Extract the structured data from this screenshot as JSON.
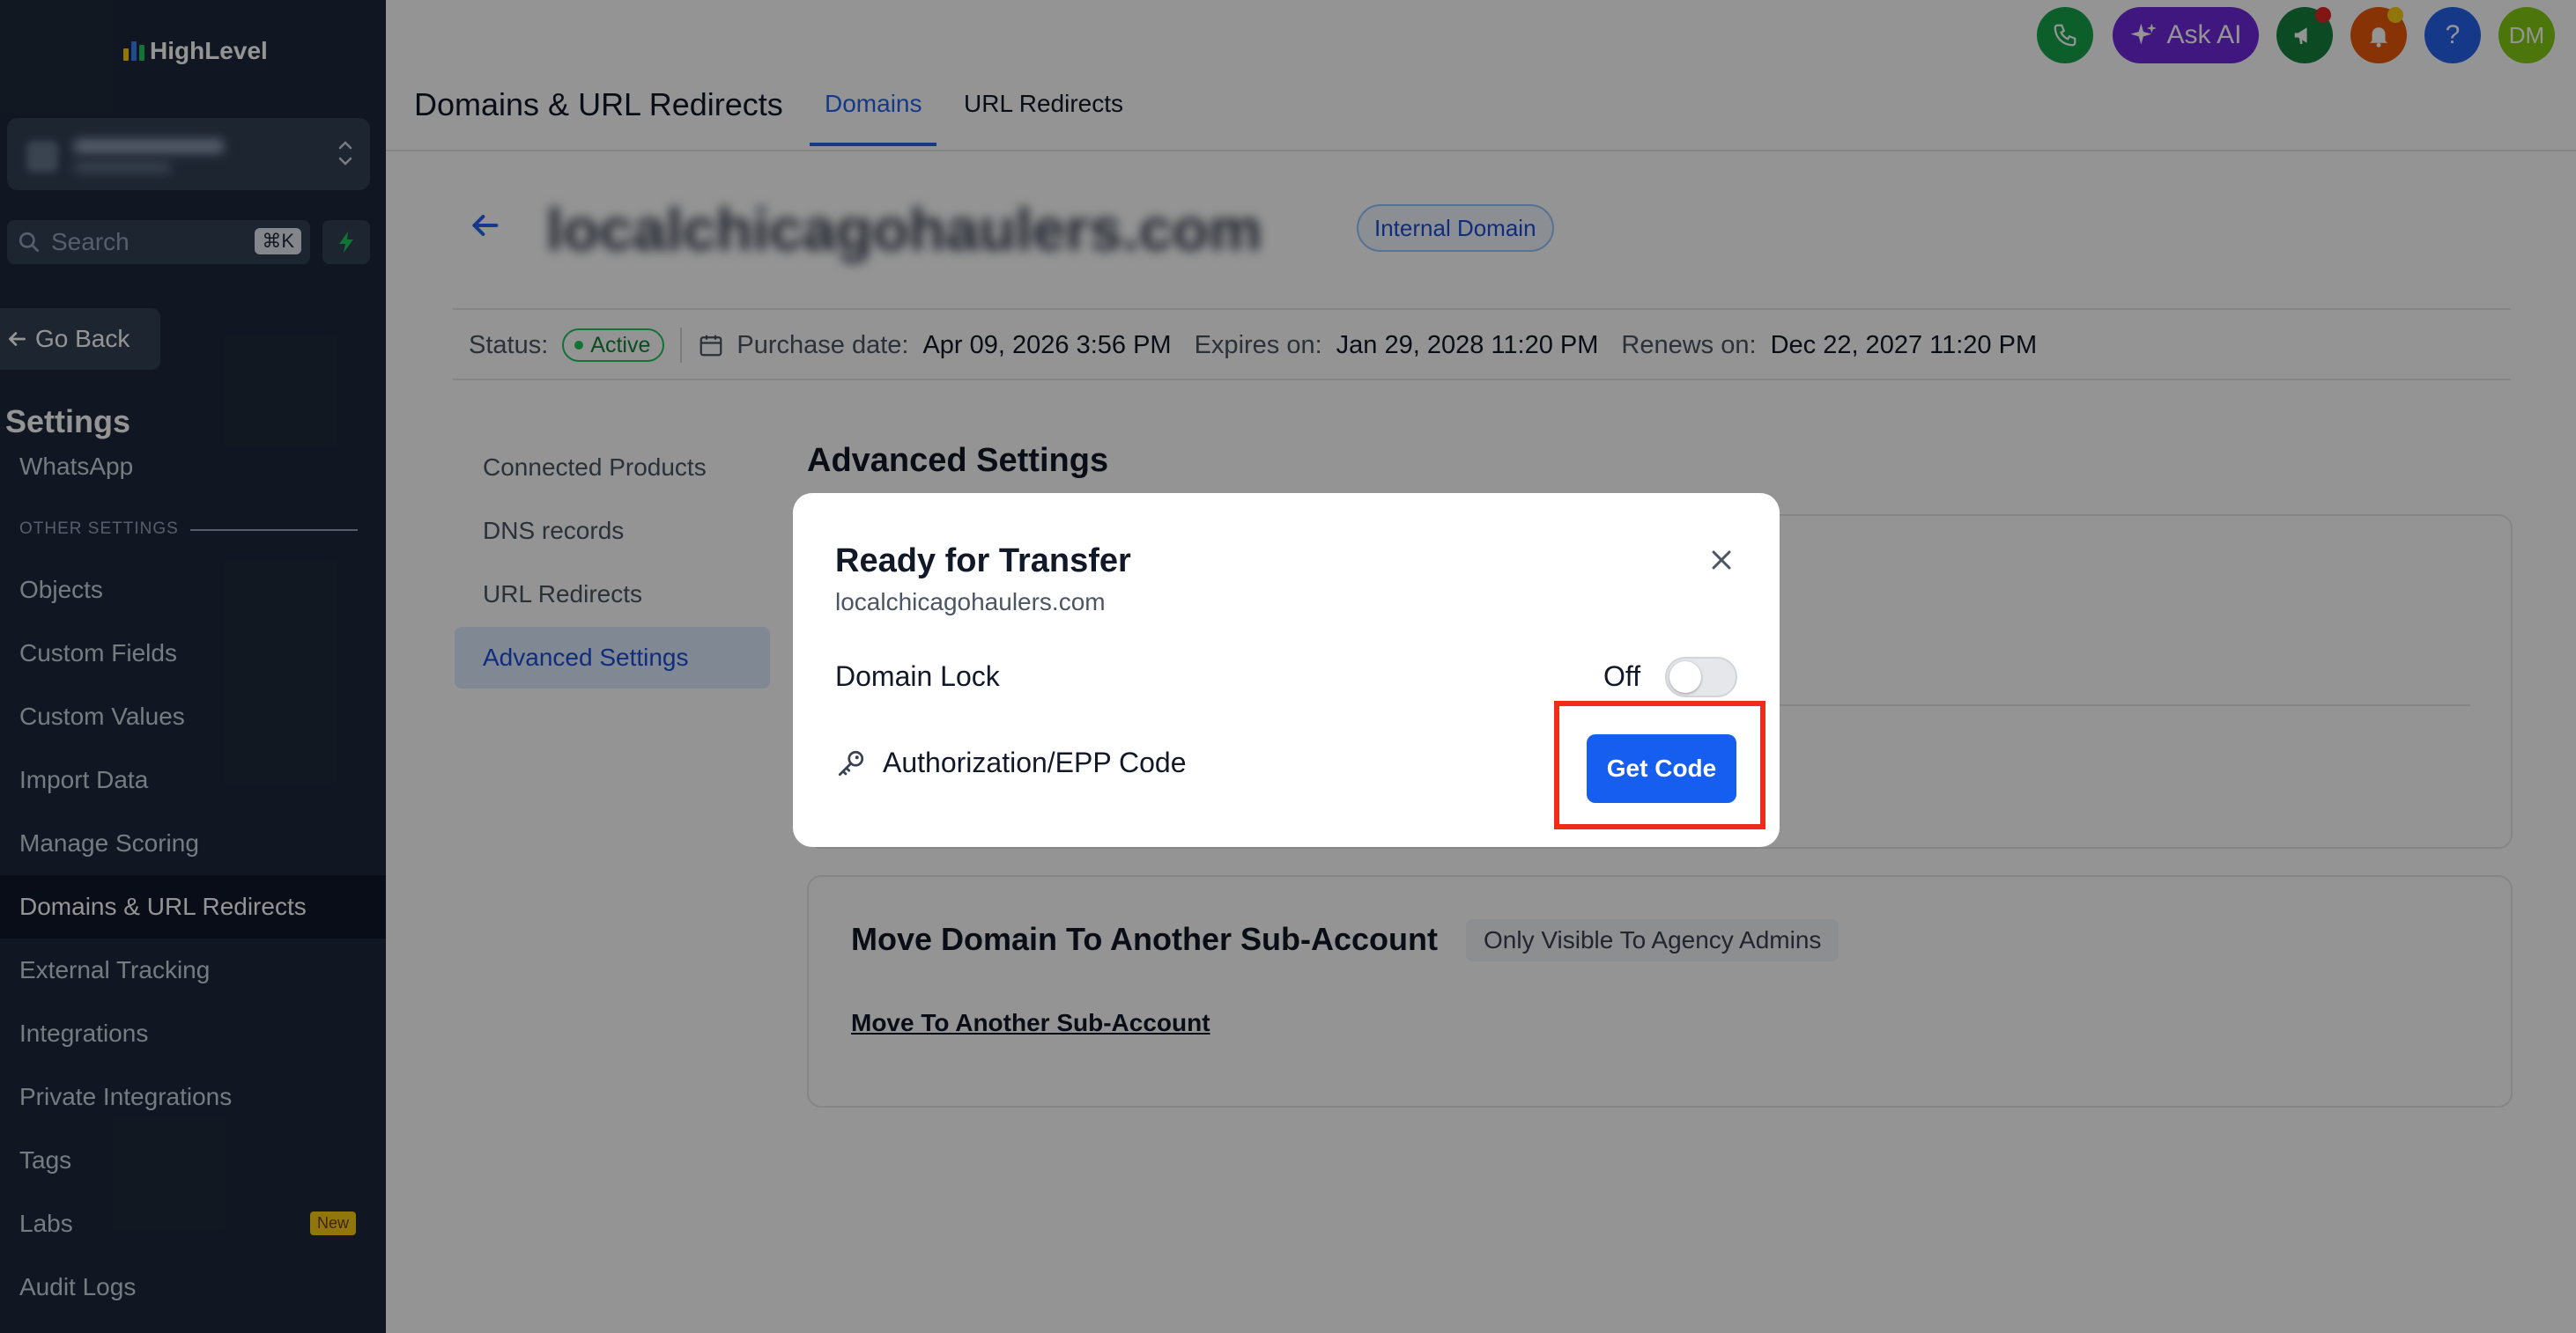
{
  "app": {
    "logo_text": "HighLevel"
  },
  "sidebar": {
    "search_placeholder": "Search",
    "search_shortcut": "⌘K",
    "go_back": "Go Back",
    "settings_title": "Settings",
    "partial_item": "WhatsApp",
    "section_label": "OTHER SETTINGS",
    "items": [
      {
        "label": "Objects"
      },
      {
        "label": "Custom Fields"
      },
      {
        "label": "Custom Values"
      },
      {
        "label": "Import Data"
      },
      {
        "label": "Manage Scoring"
      },
      {
        "label": "Domains & URL Redirects",
        "active": true
      },
      {
        "label": "External Tracking"
      },
      {
        "label": "Integrations"
      },
      {
        "label": "Private Integrations"
      },
      {
        "label": "Tags"
      },
      {
        "label": "Labs",
        "badge": "New"
      },
      {
        "label": "Audit Logs"
      }
    ]
  },
  "header": {
    "title": "Domains & URL Redirects",
    "tabs": [
      {
        "label": "Domains",
        "active": true
      },
      {
        "label": "URL Redirects"
      }
    ],
    "ask_ai": "Ask AI",
    "avatar_initials": "DM",
    "help_label": "?"
  },
  "domain": {
    "name": "localchicagohaulers.com",
    "type_badge": "Internal Domain",
    "status_label": "Status:",
    "status_value": "Active",
    "purchase_label": "Purchase date:",
    "purchase_value": "Apr 09, 2026 3:56 PM",
    "expires_label": "Expires on:",
    "expires_value": "Jan 29, 2028 11:20 PM",
    "renews_label": "Renews on:",
    "renews_value": "Dec 22, 2027 11:20 PM"
  },
  "subnav": [
    {
      "label": "Connected Products"
    },
    {
      "label": "DNS records"
    },
    {
      "label": "URL Redirects"
    },
    {
      "label": "Advanced Settings",
      "active": true
    }
  ],
  "advanced": {
    "title": "Advanced Settings",
    "move_title": "Move Domain To Another Sub-Account",
    "move_badge": "Only Visible To Agency Admins",
    "move_link": "Move To Another Sub-Account"
  },
  "modal": {
    "title": "Ready for Transfer",
    "subtitle": "localchicagohaulers.com",
    "domain_lock_label": "Domain Lock",
    "domain_lock_state": "Off",
    "epp_label": "Authorization/EPP Code",
    "get_code": "Get Code"
  },
  "colors": {
    "accent": "#2563eb",
    "primary_button": "#155eef",
    "highlight": "#ef2b1a",
    "sidebar_bg": "#1e293b"
  }
}
